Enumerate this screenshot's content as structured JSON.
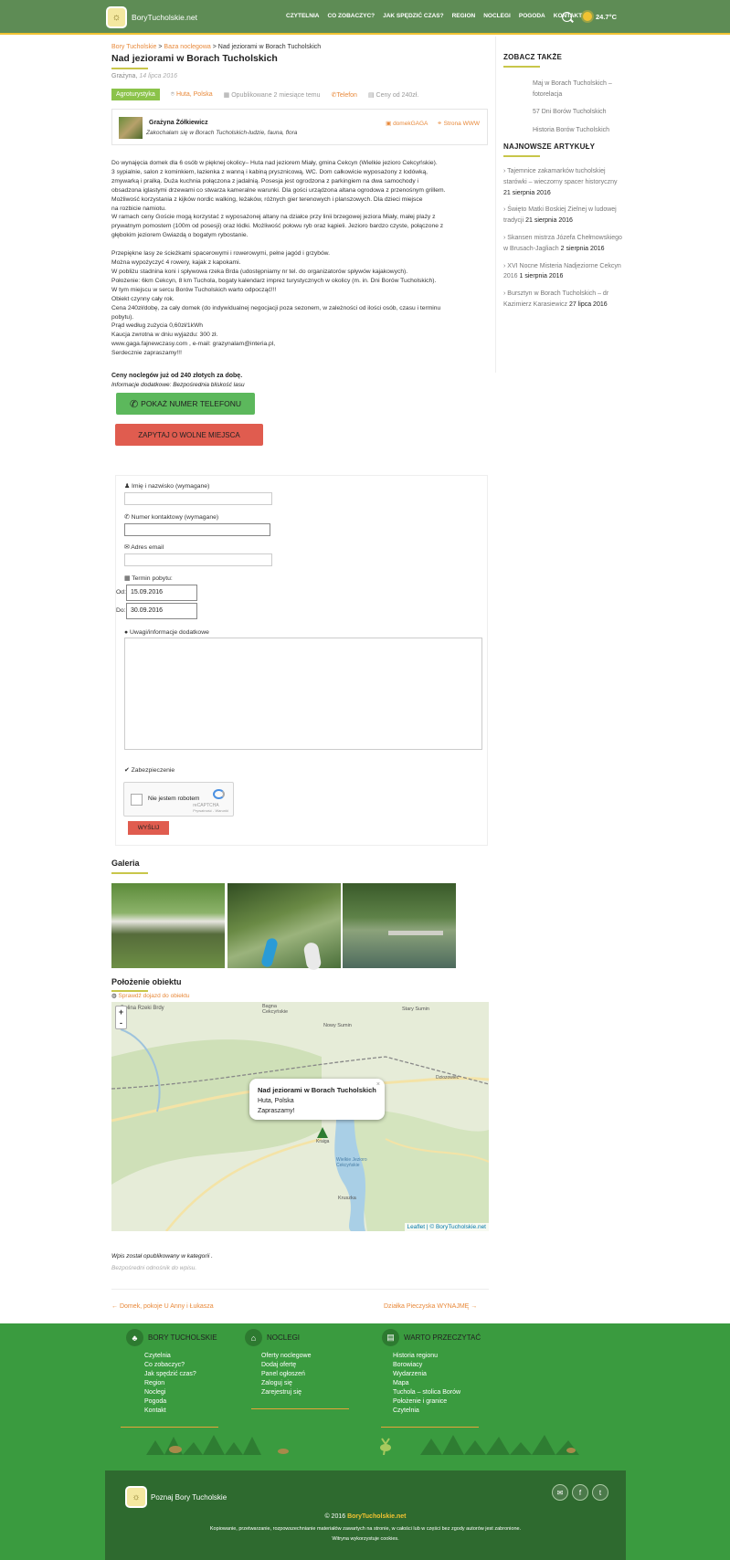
{
  "header": {
    "logo_glyph": "☼",
    "logo_text": "BoryTucholskie.net",
    "nav": [
      "CZYTELNIA",
      "CO ZOBACZYC?",
      "JAK SPĘDZIĆ CZAS?",
      "REGION",
      "NOCLEGI",
      "POGODA",
      "KONTAKT"
    ],
    "temperature": "24.7°C"
  },
  "breadcrumb": {
    "a": "Bory Tucholskie",
    "b": "Baza noclegowa",
    "current": "Nad jeziorami w Borach Tucholskich"
  },
  "title": "Nad jeziorami w Borach Tucholskich",
  "author_line": {
    "author": "Grażyna",
    "date": "14 lipca 2016"
  },
  "meta": {
    "category": "Agroturystyka",
    "location": "Huta, Polska",
    "published": "Opublikowane 2 miesiące temu",
    "phone": "Telefon",
    "price": "Ceny od 240zł."
  },
  "owner": {
    "name": "Grażyna Żółkiewicz",
    "motto": "Zakochałam się w Borach Tucholskich-ludzie, fauna, flora",
    "fb": "domekGAGA",
    "www": "Strona WWW"
  },
  "desc": [
    "Do wynajęcia domek dla 6 osób w pięknej okolicy– Huta nad jeziorem Miały, gmina Cekcyn (Wielkie jezioro Cekcyńskie).",
    "3 sypialnie, salon z kominkiem, łazienka z wanną i kabiną prysznicową, WC. Dom całkowicie wyposażony z lodówką,",
    "zmywarką i pralką. Duża kuchnia połączona z jadalnią. Posesja jest ogrodzona z parkingiem na dwa samochody i",
    "obsadzona iglastymi drzewami co stwarza kameralne warunki. Dla gości urządzona altana ogrodowa z przenośnym grillem.",
    "Możliwość korzystania z kijków nordic walking, leżaków, różnych gier terenowych i planszowych.              Dla dzieci miejsce",
    "na rozbicie namiotu.",
    "W ramach ceny Goście mogą korzystać z wyposażonej altany na działce przy linii brzegowej jeziora Miały, małej plaży z",
    "prywatnym pomostem (100m od posesji) oraz łódki.  Możliwość połowu ryb oraz kąpieli. Jezioro bardzo czyste, połączone z",
    "głębokim jeziorem Gwiazdą o bogatym rybostanie."
  ],
  "desc2": [
    "Przepiękne lasy ze ścieżkami spacerowymi i rowerowymi, pełne jagód i grzybów.",
    "Można wypożyczyć 4 rowery, kajak z kapokami.",
    "W pobliżu stadnina koni i spływowa rzeka Brda (udostępniamy nr tel. do organizatorów spływów kajakowych).",
    "Położenie: 6km Cekcyn, 8 km Tuchola, bogaty kalendarz imprez turystycznych w okolicy (m. in. Dni Borów Tucholskich).",
    "W tym miejscu w sercu Borów Tucholskich warto odpocząć!!!",
    "Obiekt czynny cały rok.",
    "Cena 240zł/dobę, za cały domek (do indywidualnej negocjacji poza sezonem, w zależności od ilości osób, czasu i terminu",
    "pobytu).",
    "Prąd według zużycia 0,60zł/1kWh",
    "Kaucja zwrotna w dniu wyjazdu: 300 zł.",
    "www.gaga.fajnewczasy.com  , e-mail: grazynalam@interia.pl,",
    "Serdecznie zapraszamy!!!"
  ],
  "price_line": "Ceny noclegów już od 240 złotych za dobę.",
  "info_line": "Informacje dodatkowe: Bezpośrednia bliskość lasu",
  "btn_phone": "POKAŻ NUMER TELEFONU",
  "btn_ask": "ZAPYTAJ O WOLNE MIEJSCA",
  "form": {
    "name_label": "Imię i nazwisko (wymagane)",
    "phone_label": "Numer kontaktowy (wymagane)",
    "email_label": "Adres email",
    "term_label": "Termin pobytu:",
    "from_label": "Od:",
    "from_value": "15.09.2016",
    "to_label": "Do:",
    "to_value": "30.09.2016",
    "notes_label": "Uwagi/informacje dodatkowe",
    "security_label": "Zabezpieczenie",
    "captcha_text": "Nie jestem robotem",
    "captcha_brand": "reCAPTCHA",
    "captcha_small": "Prywatność - Warunki",
    "send": "WYŚLIJ"
  },
  "gallery_title": "Galeria",
  "map": {
    "title": "Położenie obiektu",
    "route_link": "Sprawdź dojazd do obiektu",
    "popup_title": "Nad jeziorami w Borach Tucholskich",
    "popup_line1": "Huta, Polska",
    "popup_line2": "Zapraszamy!",
    "attribution": "Leaflet | © BoryTucholskie.net",
    "labels": [
      "Dolina Rzeki Brdy",
      "Bagna Cekcyńskie",
      "Nowy Sumin",
      "Stary Sumin",
      "Dziozowiec",
      "Kruszka",
      "Wielkie Jezioro Cekcyńskie",
      "Kraiga"
    ]
  },
  "footer_post": {
    "line1": "Wpis został opublikowany w kategorii .",
    "line2": "Bezpośredni odnośnik do wpisu."
  },
  "post_nav": {
    "prev": "← Domek, pokoje U Anny i Łukasza",
    "next": "Działka Pieczyska WYNAJMĘ →"
  },
  "sidebar": {
    "see_also": "ZOBACZ TAKŻE",
    "links": [
      "Maj w Borach Tucholskich – fotorelacja",
      "57 Dni Borów Tucholskich",
      "Historia Borów Tucholskich"
    ],
    "newest": "NAJNOWSZE ARTYKUŁY",
    "articles": [
      {
        "t": "Tajemnice zakamarków tucholskiej starówki – wieczorny spacer historyczny",
        "d": "21 sierpnia 2016"
      },
      {
        "t": "Święto Matki Boskiej Zielnej w ludowej tradycji",
        "d": "21 sierpnia 2016"
      },
      {
        "t": "Skansen mistrza Józefa Chełmowskiego w Brusach-Jagliach",
        "d": "2 sierpnia 2016"
      },
      {
        "t": "XVI Nocne Misteria Nadjeziorne Cekcyn 2016",
        "d": "1 sierpnia 2016"
      },
      {
        "t": "Bursztyn w Borach Tucholskich – dr Kazimierz Karasiewicz",
        "d": "27 lipca 2016"
      }
    ]
  },
  "footer": {
    "col1_title": "BORY TUCHOLSKIE",
    "col1": [
      "Czytelnia",
      "Co zobaczyc?",
      "Jak spędzić czas?",
      "Region",
      "Noclegi",
      "Pogoda",
      "Kontakt"
    ],
    "col2_title": "NOCLEGI",
    "col2": [
      "Oferty noclegowe",
      "Dodaj ofertę",
      "Panel ogłoszeń",
      "Zaloguj się",
      "Zarejestruj się"
    ],
    "col3_title": "WARTO PRZECZYTAĆ",
    "col3": [
      "Historia regionu",
      "Borowiacy",
      "Wydarzenia",
      "Mapa",
      "Tuchola – stolica Borów",
      "Położenie i granice",
      "Czytelnia"
    ],
    "brand": "Poznaj Bory Tucholskie",
    "copyright_prefix": "© 2016 ",
    "copyright_site": "BoryTucholskie.net",
    "rights": "Kopiowanie, przetwarzanie, rozpowszechnianie materiałów zawartych na stronie, w całości lub w części bez zgody autorów jest zabronione.",
    "cookies": "Witryna wykorzystuje cookies."
  }
}
